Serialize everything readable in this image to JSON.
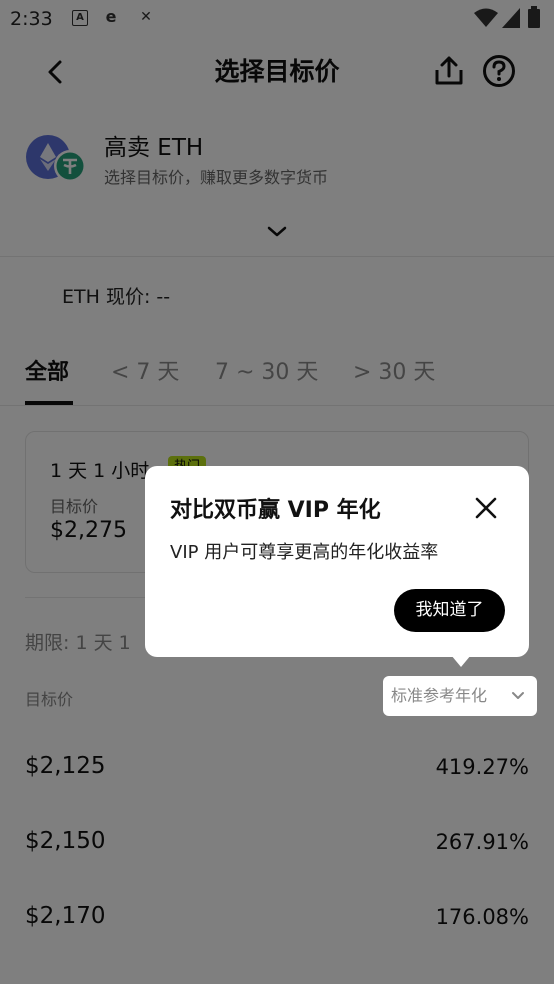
{
  "status_bar": {
    "time": "2:33",
    "notif_icons": [
      "a-icon",
      "e-icon",
      "x-icon"
    ],
    "right_icons": [
      "wifi-icon",
      "signal-icon",
      "battery-icon"
    ]
  },
  "header": {
    "title": "选择目标价"
  },
  "asset": {
    "title": "高卖 ETH",
    "subtitle": "选择目标价，赚取更多数字货币",
    "icons": [
      "ethereum-icon",
      "tether-icon"
    ]
  },
  "price": {
    "label": "ETH 现价: --"
  },
  "tabs": [
    "全部",
    "< 7 天",
    "7 ~ 30 天",
    "> 30 天"
  ],
  "active_tab": 0,
  "card": {
    "duration": "1 天 1 小时",
    "badge": "热门",
    "target_label": "目标价",
    "target_value": "$2,275"
  },
  "term": {
    "label": "期限: 1 天 1"
  },
  "table": {
    "col_left": "目标价",
    "col_right_dropdown": "标准参考年化",
    "rows": [
      {
        "price": "$2,125",
        "rate": "419.27%"
      },
      {
        "price": "$2,150",
        "rate": "267.91%"
      },
      {
        "price": "$2,170",
        "rate": "176.08%"
      }
    ]
  },
  "popup": {
    "title": "对比双币赢 VIP 年化",
    "description": "VIP 用户可尊享更高的年化收益率",
    "button": "我知道了"
  },
  "colors": {
    "badge": "#b8e01a",
    "eth": "#5b6fd6",
    "tether": "#26a17b",
    "overlay": "rgba(0,0,0,0.5)"
  }
}
